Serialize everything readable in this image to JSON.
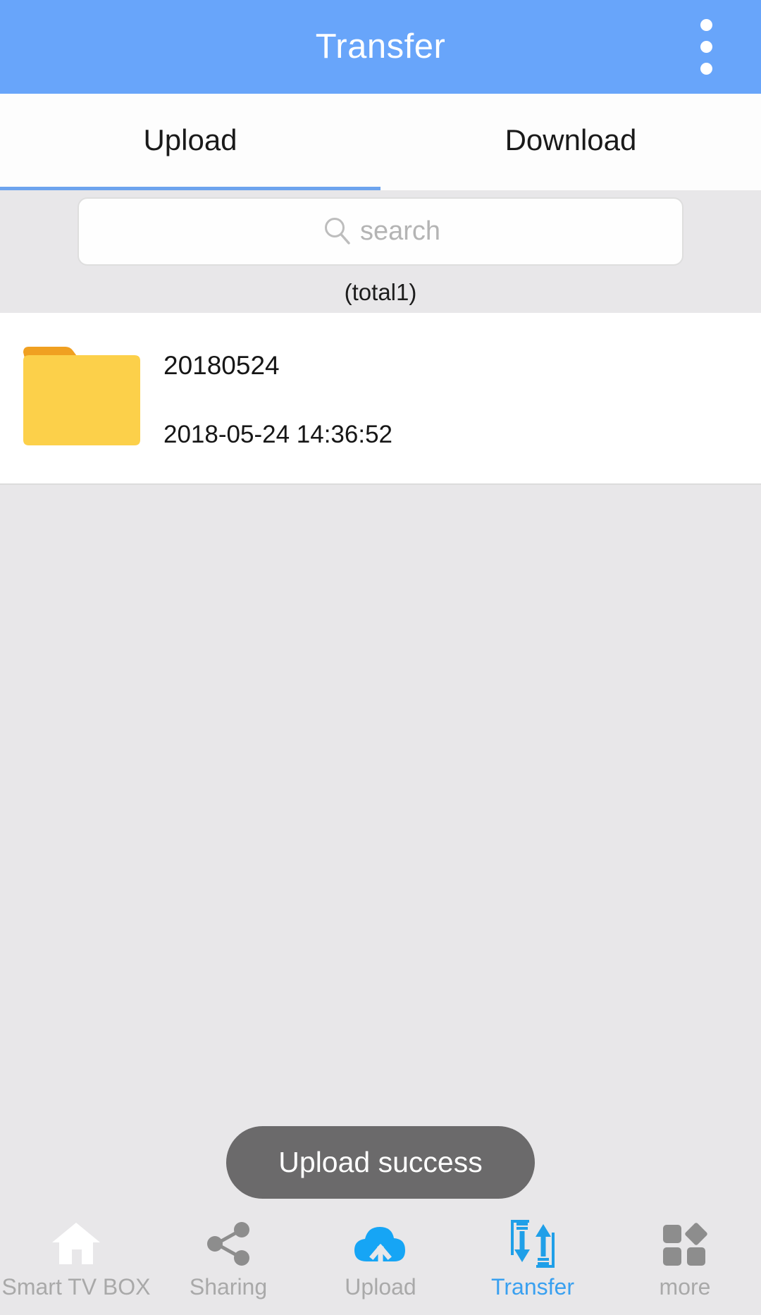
{
  "appbar": {
    "title": "Transfer",
    "overflow_icon": "more-vertical-icon",
    "background_color": "#68a5fa",
    "title_color": "#ffffff"
  },
  "tabs": {
    "items": [
      {
        "label": "Upload",
        "active": true
      },
      {
        "label": "Download",
        "active": false
      }
    ],
    "indicator_color": "#6da4ee"
  },
  "search": {
    "icon": "search-icon",
    "placeholder": "search",
    "value": ""
  },
  "list": {
    "total_label": "(total1)",
    "rows": [
      {
        "icon": "folder-icon",
        "name": "20180524",
        "date": "2018-05-24 14:36:52"
      }
    ]
  },
  "toast": {
    "message": "Upload success",
    "background_color": "#6b6a6b",
    "text_color": "#ffffff"
  },
  "bottom_nav": {
    "active_color": "#39a0f0",
    "inactive_color": "#a9a9a9",
    "items": [
      {
        "label": "Smart TV BOX",
        "icon": "home-icon",
        "active": false
      },
      {
        "label": "Sharing",
        "icon": "share-icon",
        "active": false
      },
      {
        "label": "Upload",
        "icon": "cloud-upload-icon",
        "active": false
      },
      {
        "label": "Transfer",
        "icon": "transfer-arrows-icon",
        "active": true
      },
      {
        "label": "more",
        "icon": "grid-more-icon",
        "active": false
      }
    ]
  }
}
